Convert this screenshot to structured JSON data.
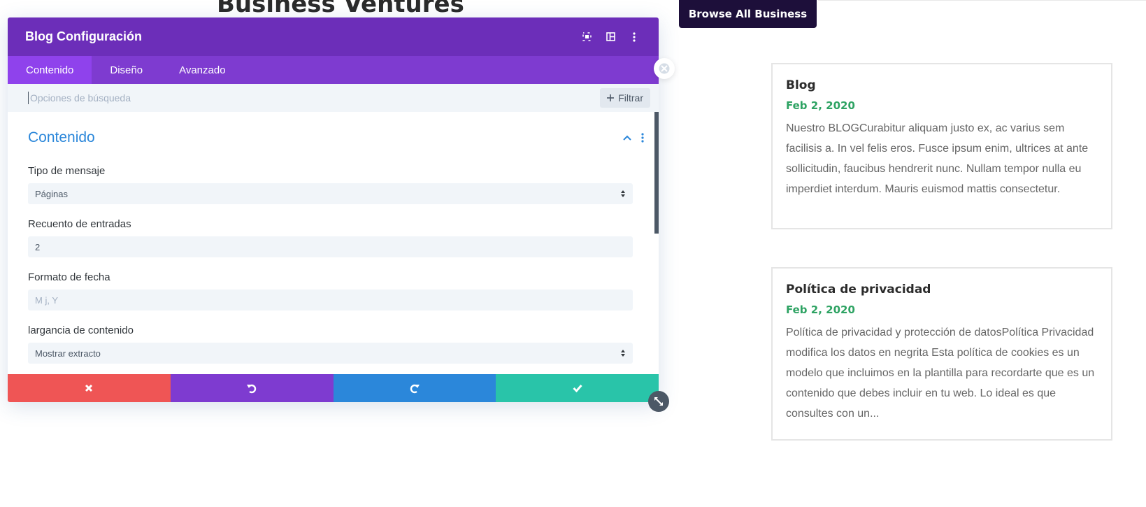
{
  "background": {
    "heading": "Business Ventures",
    "browse_button": "Browse All Business",
    "posts": [
      {
        "title": "Blog",
        "date": "Feb 2, 2020",
        "excerpt": "Nuestro BLOGCurabitur aliquam justo ex, ac varius sem facilisis a. In vel felis eros. Fusce ipsum enim, ultrices at ante sollicitudin, faucibus hendrerit nunc. Nullam tempor nulla eu imperdiet interdum. Mauris euismod mattis consectetur."
      },
      {
        "title": "Política de privacidad",
        "date": "Feb 2, 2020",
        "excerpt": "Política de privacidad y protección de datosPolítica Privacidad modifica los datos en negrita   Esta política de cookies es un modelo que incluimos en la plantilla para recordarte que es un contenido que debes incluir en tu web. Lo ideal es que consultes con un..."
      }
    ]
  },
  "modal": {
    "title": "Blog Configuración",
    "header_icons": [
      "fullscreen-icon",
      "split-view-icon",
      "more-vertical-icon"
    ],
    "tabs": [
      {
        "label": "Contenido",
        "active": true
      },
      {
        "label": "Diseño",
        "active": false
      },
      {
        "label": "Avanzado",
        "active": false
      }
    ],
    "search": {
      "placeholder": "Opciones de búsqueda",
      "value": ""
    },
    "filter_label": "Filtrar",
    "section": {
      "title": "Contenido"
    },
    "fields": [
      {
        "label": "Tipo de mensaje",
        "value": "Páginas",
        "type": "select"
      },
      {
        "label": "Recuento de entradas",
        "value": "2",
        "type": "text"
      },
      {
        "label": "Formato de fecha",
        "value": "M j, Y",
        "type": "placeholder"
      },
      {
        "label": "largancia de contenido",
        "value": "Mostrar extracto",
        "type": "select"
      }
    ],
    "footer_buttons": [
      "close-icon",
      "undo-icon",
      "redo-icon",
      "check-icon"
    ]
  },
  "colors": {
    "header": "#6c2eb9",
    "tabs": "#7e3bd0",
    "active_tab": "#8f42ec",
    "accent_blue": "#2b87da",
    "cancel": "#ef5555",
    "save": "#29c4a9",
    "date_green": "#2ea363"
  }
}
